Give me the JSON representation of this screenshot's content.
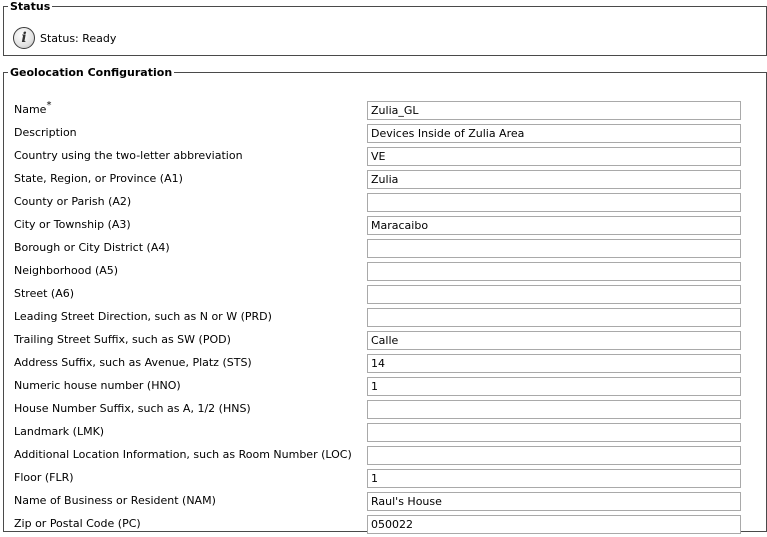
{
  "status": {
    "legend": "Status",
    "icon": "info-icon",
    "text": "Status: Ready"
  },
  "geolocation": {
    "legend": "Geolocation Configuration",
    "required_marker": "*",
    "fields": [
      {
        "label": "Name",
        "value": "Zulia_GL",
        "required": true
      },
      {
        "label": "Description",
        "value": "Devices Inside of Zulia Area"
      },
      {
        "label": "Country using the two-letter abbreviation",
        "value": "VE"
      },
      {
        "label": "State, Region, or Province (A1)",
        "value": "Zulia"
      },
      {
        "label": "County or Parish (A2)",
        "value": ""
      },
      {
        "label": "City or Township (A3)",
        "value": "Maracaibo"
      },
      {
        "label": "Borough or City District (A4)",
        "value": ""
      },
      {
        "label": "Neighborhood (A5)",
        "value": ""
      },
      {
        "label": "Street (A6)",
        "value": ""
      },
      {
        "label": "Leading Street Direction, such as N or W (PRD)",
        "value": ""
      },
      {
        "label": "Trailing Street Suffix, such as SW (POD)",
        "value": "Calle"
      },
      {
        "label": "Address Suffix, such as Avenue, Platz (STS)",
        "value": "14"
      },
      {
        "label": "Numeric house number (HNO)",
        "value": "1"
      },
      {
        "label": "House Number Suffix, such as A, 1/2 (HNS)",
        "value": ""
      },
      {
        "label": "Landmark (LMK)",
        "value": ""
      },
      {
        "label": "Additional Location Information, such as Room Number (LOC)",
        "value": ""
      },
      {
        "label": "Floor (FLR)",
        "value": "1"
      },
      {
        "label": "Name of Business or Resident (NAM)",
        "value": "Raul's House"
      },
      {
        "label": "Zip or Postal Code (PC)",
        "value": "050022"
      }
    ]
  }
}
